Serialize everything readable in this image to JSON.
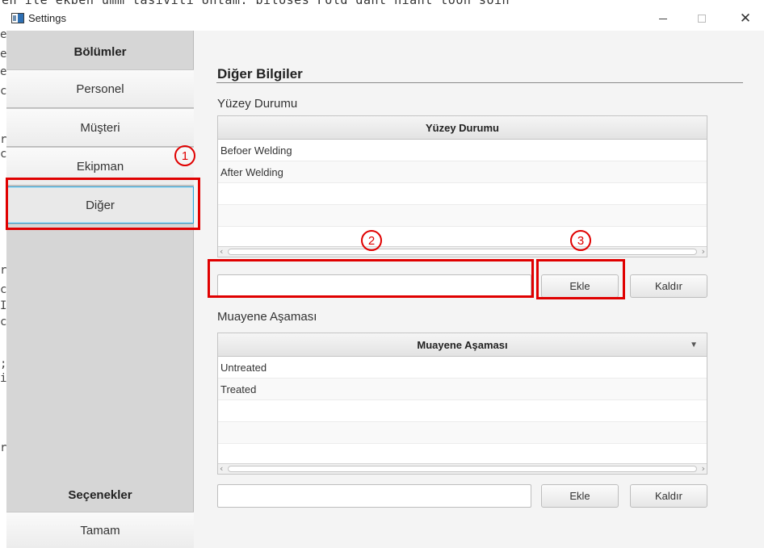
{
  "window": {
    "title": "Settings"
  },
  "sidebar": {
    "section_heading": "Bölümler",
    "items": [
      {
        "label": "Personel"
      },
      {
        "label": "Müşteri"
      },
      {
        "label": "Ekipman"
      },
      {
        "label": "Diğer",
        "active": true
      }
    ],
    "options_heading": "Seçenekler",
    "ok_label": "Tamam"
  },
  "main": {
    "section_title": "Diğer Bilgiler",
    "surface": {
      "group_label": "Yüzey Durumu",
      "column_header": "Yüzey Durumu",
      "rows": [
        "Befoer Welding",
        "After Welding",
        "",
        "",
        ""
      ],
      "input_value": "",
      "add_label": "Ekle",
      "remove_label": "Kaldır"
    },
    "inspection": {
      "group_label": "Muayene Aşaması",
      "column_header": "Muayene Aşaması",
      "rows": [
        "Untreated",
        "Treated",
        "",
        "",
        ""
      ],
      "input_value": "",
      "add_label": "Ekle",
      "remove_label": "Kaldır"
    }
  },
  "annotations": {
    "step1": "1",
    "step2": "2",
    "step3": "3",
    "color": "#e00000"
  },
  "colors": {
    "accent": "#2da3d6",
    "sidebar_bg": "#d6d6d6",
    "content_bg": "#f4f4f4"
  },
  "icons": {
    "app": "window-app-icon",
    "minimize": "minimize-icon",
    "maximize": "maximize-icon",
    "close": "close-icon",
    "sort": "sort-down-icon"
  },
  "background": {
    "top_line": "en ile ekben ümm tasiviti Untam: biloses Fold dant niant toon soin"
  }
}
